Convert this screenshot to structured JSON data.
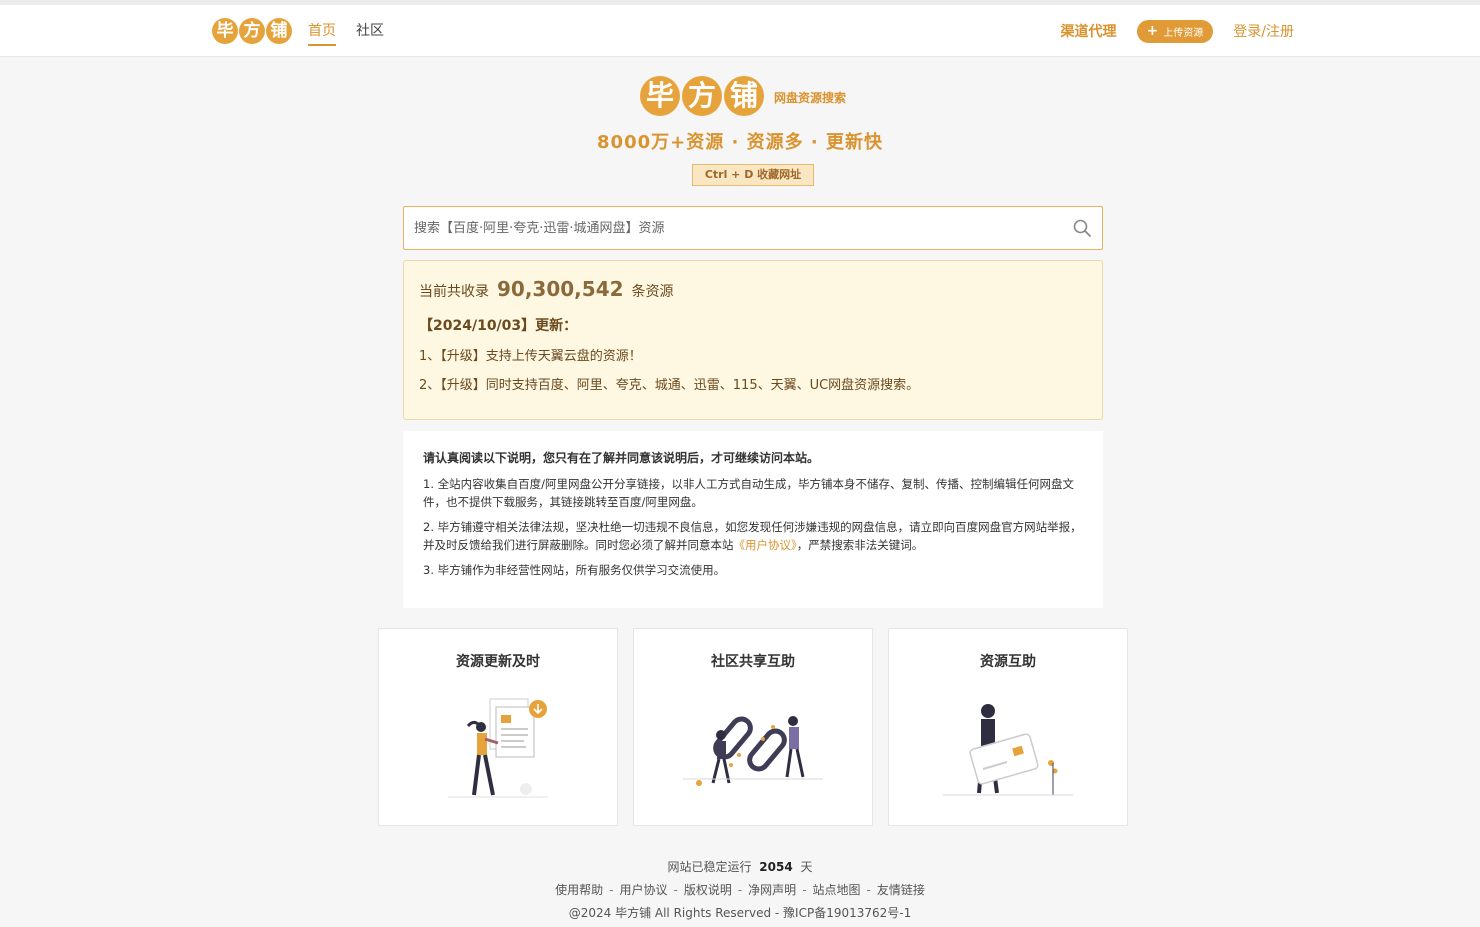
{
  "header": {
    "logo_chars": [
      "毕",
      "方",
      "铺"
    ],
    "nav": [
      {
        "label": "首页",
        "active": true
      },
      {
        "label": "社区",
        "active": false
      }
    ],
    "channel_label": "渠道代理",
    "upload_label": "上传资源",
    "login_label": "登录/注册"
  },
  "hero": {
    "logo_chars": [
      "毕",
      "方",
      "铺"
    ],
    "subtitle": "网盘资源搜索",
    "slogan": "8000万+资源 · 资源多 · 更新快",
    "bookmark_hint": "Ctrl + D 收藏网址"
  },
  "search": {
    "placeholder": "搜索【百度·阿里·夸克·迅雷·城通网盘】资源"
  },
  "notice": {
    "count_prefix": "当前共收录",
    "count_value": "90,300,542",
    "count_suffix": "条资源",
    "update_title": "【2024/10/03】更新：",
    "items": [
      "1、【升级】支持上传天翼云盘的资源！",
      "2、【升级】同时支持百度、阿里、夸克、城通、迅雷、115、天翼、UC网盘资源搜索。"
    ]
  },
  "disclaimer": {
    "head": "请认真阅读以下说明，您只有在了解并同意该说明后，才可继续访问本站。",
    "p1": "1. 全站内容收集自百度/阿里网盘公开分享链接，以非人工方式自动生成，毕方铺本身不储存、复制、传播、控制编辑任何网盘文件，也不提供下载服务，其链接跳转至百度/阿里网盘。",
    "p2_a": "2. 毕方铺遵守相关法律法规，坚决杜绝一切违规不良信息，如您发现任何涉嫌违规的网盘信息，请立即向百度网盘官方网站举报，并及时反馈给我们进行屏蔽删除。同时您必须了解并同意本站",
    "p2_link": "《用户协议》",
    "p2_b": "，严禁搜索非法关键词。",
    "p3": "3. 毕方铺作为非经营性网站，所有服务仅供学习交流使用。"
  },
  "cards": [
    {
      "title": "资源更新及时"
    },
    {
      "title": "社区共享互助"
    },
    {
      "title": "资源互助"
    }
  ],
  "footer": {
    "uptime_prefix": "网站已稳定运行",
    "uptime_days": "2054",
    "uptime_suffix": "天",
    "links": [
      "使用帮助",
      "用户协议",
      "版权说明",
      "净网声明",
      "站点地图",
      "友情链接"
    ],
    "copyright": "@2024 毕方铺 All Rights Reserved - 豫ICP备19013762号-1"
  },
  "colors": {
    "accent": "#d9932f",
    "coin": "#e6a33c",
    "notice_bg": "#fef7e1"
  }
}
